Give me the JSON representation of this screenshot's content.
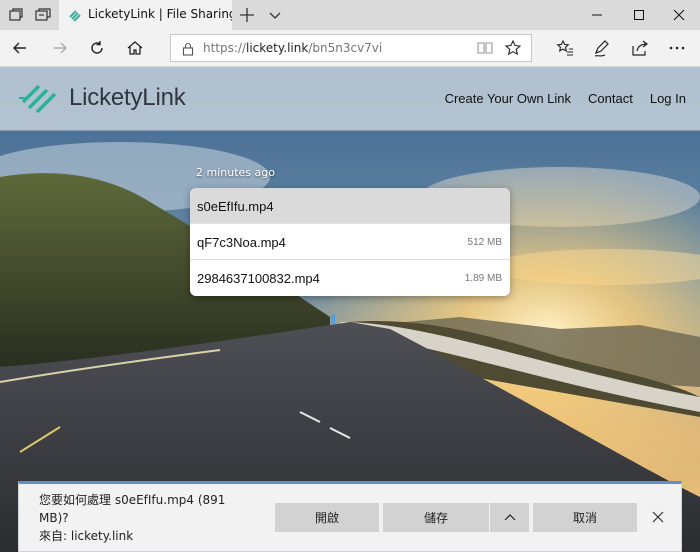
{
  "browser": {
    "tab_title": "LicketyLink | File Sharing",
    "url_scheme": "https://",
    "url_host": "lickety.link",
    "url_path": "/bn5n3cv7vi"
  },
  "site": {
    "logo_text": "LicketyLink",
    "brand_color": "#2bb39a",
    "nav": [
      "Create Your Own Link",
      "Contact",
      "Log In"
    ]
  },
  "upload": {
    "time_ago": "2 minutes ago",
    "files": [
      {
        "name": "s0eEfIfu.mp4",
        "size": ""
      },
      {
        "name": "qF7c3Noa.mp4",
        "size": "512 MB"
      },
      {
        "name": "2984637100832.mp4",
        "size": "1.89 MB"
      }
    ]
  },
  "download_prompt": {
    "line1": "您要如何處理 s0eEfIfu.mp4 (891 MB)?",
    "line2": "來自: lickety.link",
    "open_label": "開啟",
    "save_label": "儲存",
    "cancel_label": "取消"
  }
}
